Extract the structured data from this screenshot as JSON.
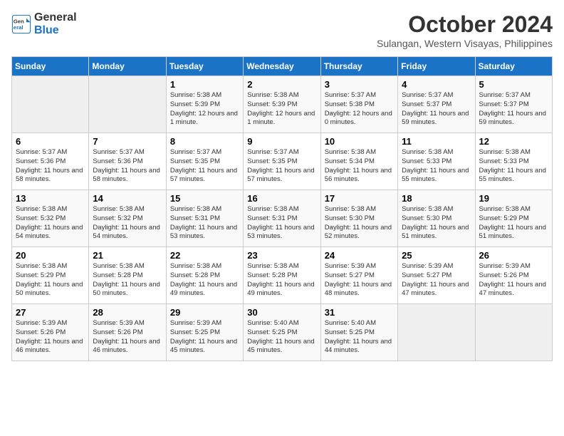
{
  "header": {
    "logo_line1": "General",
    "logo_line2": "Blue",
    "month": "October 2024",
    "location": "Sulangan, Western Visayas, Philippines"
  },
  "days_of_week": [
    "Sunday",
    "Monday",
    "Tuesday",
    "Wednesday",
    "Thursday",
    "Friday",
    "Saturday"
  ],
  "weeks": [
    [
      {
        "day": "",
        "content": ""
      },
      {
        "day": "",
        "content": ""
      },
      {
        "day": "1",
        "content": "Sunrise: 5:38 AM\nSunset: 5:39 PM\nDaylight: 12 hours and 1 minute."
      },
      {
        "day": "2",
        "content": "Sunrise: 5:38 AM\nSunset: 5:39 PM\nDaylight: 12 hours and 1 minute."
      },
      {
        "day": "3",
        "content": "Sunrise: 5:37 AM\nSunset: 5:38 PM\nDaylight: 12 hours and 0 minutes."
      },
      {
        "day": "4",
        "content": "Sunrise: 5:37 AM\nSunset: 5:37 PM\nDaylight: 11 hours and 59 minutes."
      },
      {
        "day": "5",
        "content": "Sunrise: 5:37 AM\nSunset: 5:37 PM\nDaylight: 11 hours and 59 minutes."
      }
    ],
    [
      {
        "day": "6",
        "content": "Sunrise: 5:37 AM\nSunset: 5:36 PM\nDaylight: 11 hours and 58 minutes."
      },
      {
        "day": "7",
        "content": "Sunrise: 5:37 AM\nSunset: 5:36 PM\nDaylight: 11 hours and 58 minutes."
      },
      {
        "day": "8",
        "content": "Sunrise: 5:37 AM\nSunset: 5:35 PM\nDaylight: 11 hours and 57 minutes."
      },
      {
        "day": "9",
        "content": "Sunrise: 5:37 AM\nSunset: 5:35 PM\nDaylight: 11 hours and 57 minutes."
      },
      {
        "day": "10",
        "content": "Sunrise: 5:38 AM\nSunset: 5:34 PM\nDaylight: 11 hours and 56 minutes."
      },
      {
        "day": "11",
        "content": "Sunrise: 5:38 AM\nSunset: 5:33 PM\nDaylight: 11 hours and 55 minutes."
      },
      {
        "day": "12",
        "content": "Sunrise: 5:38 AM\nSunset: 5:33 PM\nDaylight: 11 hours and 55 minutes."
      }
    ],
    [
      {
        "day": "13",
        "content": "Sunrise: 5:38 AM\nSunset: 5:32 PM\nDaylight: 11 hours and 54 minutes."
      },
      {
        "day": "14",
        "content": "Sunrise: 5:38 AM\nSunset: 5:32 PM\nDaylight: 11 hours and 54 minutes."
      },
      {
        "day": "15",
        "content": "Sunrise: 5:38 AM\nSunset: 5:31 PM\nDaylight: 11 hours and 53 minutes."
      },
      {
        "day": "16",
        "content": "Sunrise: 5:38 AM\nSunset: 5:31 PM\nDaylight: 11 hours and 53 minutes."
      },
      {
        "day": "17",
        "content": "Sunrise: 5:38 AM\nSunset: 5:30 PM\nDaylight: 11 hours and 52 minutes."
      },
      {
        "day": "18",
        "content": "Sunrise: 5:38 AM\nSunset: 5:30 PM\nDaylight: 11 hours and 51 minutes."
      },
      {
        "day": "19",
        "content": "Sunrise: 5:38 AM\nSunset: 5:29 PM\nDaylight: 11 hours and 51 minutes."
      }
    ],
    [
      {
        "day": "20",
        "content": "Sunrise: 5:38 AM\nSunset: 5:29 PM\nDaylight: 11 hours and 50 minutes."
      },
      {
        "day": "21",
        "content": "Sunrise: 5:38 AM\nSunset: 5:28 PM\nDaylight: 11 hours and 50 minutes."
      },
      {
        "day": "22",
        "content": "Sunrise: 5:38 AM\nSunset: 5:28 PM\nDaylight: 11 hours and 49 minutes."
      },
      {
        "day": "23",
        "content": "Sunrise: 5:38 AM\nSunset: 5:28 PM\nDaylight: 11 hours and 49 minutes."
      },
      {
        "day": "24",
        "content": "Sunrise: 5:39 AM\nSunset: 5:27 PM\nDaylight: 11 hours and 48 minutes."
      },
      {
        "day": "25",
        "content": "Sunrise: 5:39 AM\nSunset: 5:27 PM\nDaylight: 11 hours and 47 minutes."
      },
      {
        "day": "26",
        "content": "Sunrise: 5:39 AM\nSunset: 5:26 PM\nDaylight: 11 hours and 47 minutes."
      }
    ],
    [
      {
        "day": "27",
        "content": "Sunrise: 5:39 AM\nSunset: 5:26 PM\nDaylight: 11 hours and 46 minutes."
      },
      {
        "day": "28",
        "content": "Sunrise: 5:39 AM\nSunset: 5:26 PM\nDaylight: 11 hours and 46 minutes."
      },
      {
        "day": "29",
        "content": "Sunrise: 5:39 AM\nSunset: 5:25 PM\nDaylight: 11 hours and 45 minutes."
      },
      {
        "day": "30",
        "content": "Sunrise: 5:40 AM\nSunset: 5:25 PM\nDaylight: 11 hours and 45 minutes."
      },
      {
        "day": "31",
        "content": "Sunrise: 5:40 AM\nSunset: 5:25 PM\nDaylight: 11 hours and 44 minutes."
      },
      {
        "day": "",
        "content": ""
      },
      {
        "day": "",
        "content": ""
      }
    ]
  ]
}
